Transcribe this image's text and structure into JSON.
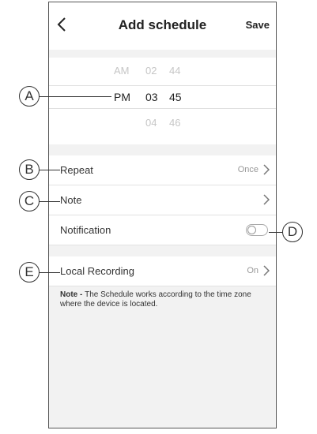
{
  "header": {
    "title": "Add schedule",
    "save_label": "Save"
  },
  "time_picker": {
    "above": {
      "period": "AM",
      "hour": "02",
      "minute": "44"
    },
    "selected": {
      "period": "PM",
      "hour": "03",
      "minute": "45"
    },
    "below": {
      "hour": "04",
      "minute": "46"
    }
  },
  "settings": {
    "repeat": {
      "label": "Repeat",
      "value": "Once"
    },
    "note": {
      "label": "Note"
    },
    "notification": {
      "label": "Notification",
      "enabled": false
    },
    "local_recording": {
      "label": "Local Recording",
      "value": "On"
    }
  },
  "footer_note": {
    "prefix": "Note - ",
    "text": "The Schedule works according to the time zone where the device is located."
  },
  "callouts": {
    "a": "A",
    "b": "B",
    "c": "C",
    "d": "D",
    "e": "E"
  }
}
